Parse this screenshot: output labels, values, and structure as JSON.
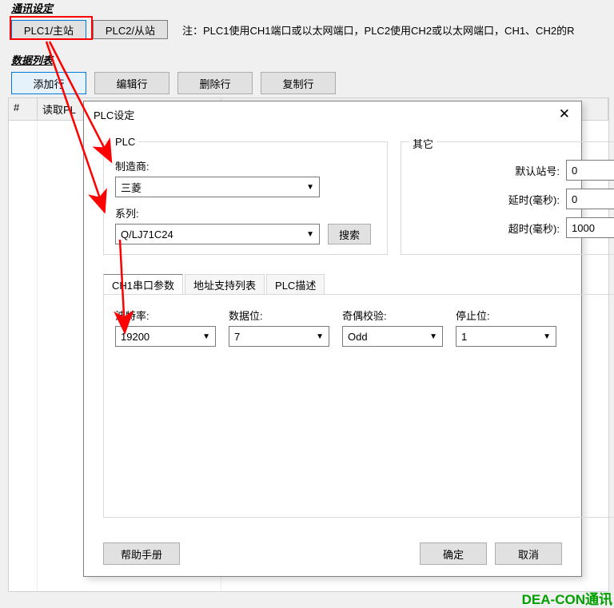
{
  "sections": {
    "comm": "通讯设定",
    "data": "数据列表"
  },
  "tabs": {
    "plc1": "PLC1/主站",
    "plc2": "PLC2/从站"
  },
  "note": "注：PLC1使用CH1端口或以太网端口，PLC2使用CH2或以太网端口，CH1、CH2的R",
  "toolbar": {
    "add": "添加行",
    "edit": "编辑行",
    "del": "删除行",
    "copy": "复制行"
  },
  "grid": {
    "col_num": "#",
    "col_read": "读取PL"
  },
  "dialog": {
    "title": "PLC设定",
    "plc_group": "PLC",
    "other_group": "其它",
    "manufacturer_label": "制造商:",
    "manufacturer_value": "三菱",
    "series_label": "系列:",
    "series_value": "Q/LJ71C24",
    "search": "搜索",
    "station_label": "默认站号:",
    "station_value": "0",
    "delay_label": "延时(毫秒):",
    "delay_value": "0",
    "timeout_label": "超时(毫秒):",
    "timeout_value": "1000",
    "inner_tabs": {
      "serial": "CH1串口参数",
      "addr": "地址支持列表",
      "desc": "PLC描述"
    },
    "params": {
      "baud_label": "波特率:",
      "baud_value": "19200",
      "databits_label": "数据位:",
      "databits_value": "7",
      "parity_label": "奇偶校验:",
      "parity_value": "Odd",
      "stopbits_label": "停止位:",
      "stopbits_value": "1"
    },
    "help": "帮助手册",
    "ok": "确定",
    "cancel": "取消"
  },
  "watermark": "DEA-CON通讯"
}
